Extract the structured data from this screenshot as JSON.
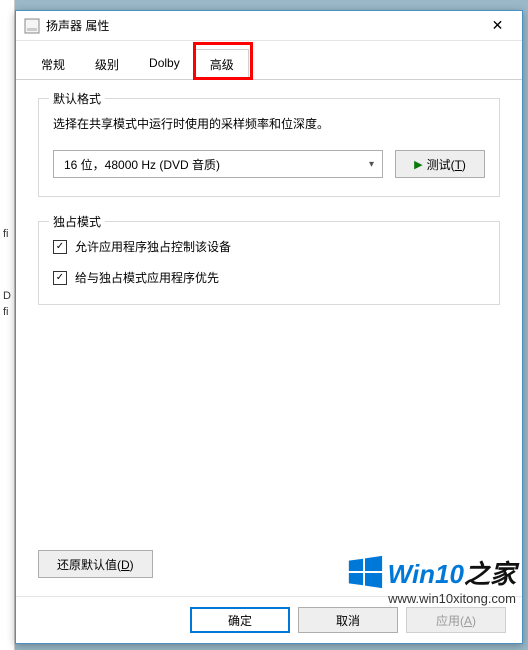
{
  "window": {
    "title": "扬声器 属性"
  },
  "tabs": [
    {
      "label": "常规"
    },
    {
      "label": "级别"
    },
    {
      "label": "Dolby"
    },
    {
      "label": "高级"
    }
  ],
  "default_format": {
    "legend": "默认格式",
    "description": "选择在共享模式中运行时使用的采样频率和位深度。",
    "selected": "16 位，48000 Hz (DVD 音质)",
    "test_label": "测试(T)"
  },
  "exclusive_mode": {
    "legend": "独占模式",
    "checkbox1": "允许应用程序独占控制该设备",
    "checkbox2": "给与独占模式应用程序优先"
  },
  "buttons": {
    "restore": "还原默认值(D)",
    "ok": "确定",
    "cancel": "取消",
    "apply": "应用(A)"
  },
  "watermark": {
    "brand1": "Win10",
    "brand2": "之家",
    "url": "www.win10xitong.com"
  },
  "fragments": {
    "f1": "fi",
    "f2": "D",
    "f3": "fi"
  }
}
